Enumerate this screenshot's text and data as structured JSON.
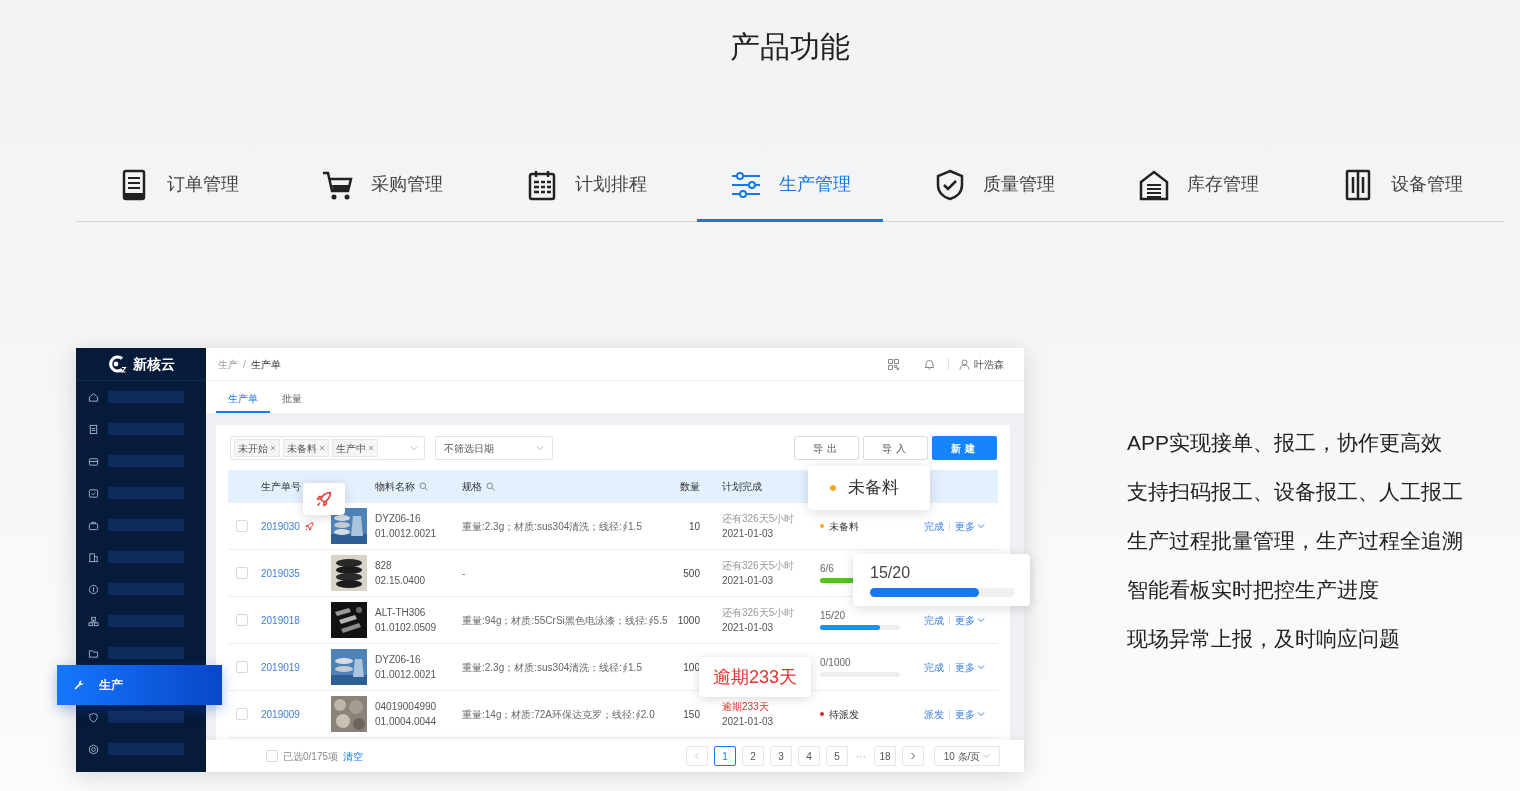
{
  "title": "产品功能",
  "feature_tabs": [
    {
      "label": "订单管理",
      "selected": false
    },
    {
      "label": "采购管理",
      "selected": false
    },
    {
      "label": "计划排程",
      "selected": false
    },
    {
      "label": "生产管理",
      "selected": true
    },
    {
      "label": "质量管理",
      "selected": false
    },
    {
      "label": "库存管理",
      "selected": false
    },
    {
      "label": "设备管理",
      "selected": false
    }
  ],
  "app": {
    "logo_text": "新核云",
    "sidebar": [
      {
        "selected": false
      },
      {
        "selected": false
      },
      {
        "selected": false
      },
      {
        "selected": false
      },
      {
        "selected": false
      },
      {
        "selected": false
      },
      {
        "selected": false
      },
      {
        "selected": false
      },
      {
        "selected": false
      },
      {
        "label": "生产",
        "selected": true
      },
      {
        "selected": false
      },
      {
        "selected": false
      }
    ],
    "breadcrumb": {
      "items": [
        "生产",
        "生产单"
      ],
      "separator": "/"
    },
    "user": "叶浩森",
    "tabs": [
      {
        "label": "生产单",
        "selected": true
      },
      {
        "label": "批量",
        "selected": false
      }
    ],
    "status_filter": {
      "tags": [
        "未开始",
        "未备料",
        "生产中"
      ]
    },
    "date_filter": {
      "value": "不筛选日期"
    },
    "buttons": [
      {
        "label": "导出",
        "kind": "default"
      },
      {
        "label": "导入",
        "kind": "default"
      },
      {
        "label": "新建",
        "kind": "primary"
      }
    ],
    "table": {
      "columns": [
        "生产单号",
        "物料名称",
        "规格",
        "数量",
        "计划完成"
      ],
      "rows": [
        {
          "checked": false,
          "id": "2019030",
          "rocket_mark": true,
          "image": {
            "kind": "picture"
          },
          "material": [
            "DYZ06-16",
            "01.0012.0021"
          ],
          "spec": "重量:2.3g；材质:sus304清洗；线径:∮1.5",
          "quantity": "10",
          "plan": {
            "remaining": "还有326天5小时",
            "overdue": false,
            "date": "2021-01-03"
          },
          "status": {
            "kind": "dot",
            "label": "未备料",
            "color": "#f5a623"
          },
          "actions": [
            "完成",
            "更多"
          ]
        },
        {
          "checked": false,
          "id": "2019035",
          "rocket_mark": false,
          "image": {
            "kind": "picture"
          },
          "material": [
            "828",
            "02.15.0400"
          ],
          "spec": "-",
          "quantity": "500",
          "plan": {
            "remaining": "还有326天5小时",
            "overdue": false,
            "date": "2021-01-03"
          },
          "status": {
            "kind": "progress",
            "reading": "6/6",
            "level": 1,
            "color": "#52c41a"
          }
        },
        {
          "checked": false,
          "id": "2019018",
          "rocket_mark": false,
          "image": {
            "kind": "picture"
          },
          "material": [
            "ALT-TH306",
            "01.0102.0509"
          ],
          "spec": "重量:94g；材质:55CrSi黑色电泳漆；线径:∮5.5",
          "quantity": "1000",
          "plan": {
            "remaining": "还有326天5小时",
            "overdue": false,
            "date": "2021-01-03"
          },
          "status": {
            "kind": "progress",
            "reading": "15/20",
            "level": 0.75,
            "color": "#1890ff"
          },
          "actions": [
            "完成",
            "更多"
          ]
        },
        {
          "checked": false,
          "id": "2019019",
          "rocket_mark": false,
          "image": {
            "kind": "picture"
          },
          "material": [
            "DYZ06-16",
            "01.0012.0021"
          ],
          "spec": "重量:2.3g；材质:sus304清洗；线径:∮1.5",
          "quantity": "100",
          "status": {
            "kind": "progress",
            "reading": "0/1000",
            "level": 0
          },
          "actions": [
            "完成",
            "更多"
          ]
        },
        {
          "checked": false,
          "id": "2019009",
          "rocket_mark": false,
          "image": {
            "kind": "picture"
          },
          "material": [
            "04019004990",
            "01.0004.0044"
          ],
          "spec": "重量:14g；材质:72A环保达克罗；线径:∮2.0",
          "quantity": "150",
          "plan": {
            "remaining": "逾期233天",
            "overdue": true,
            "date": "2021-01-03"
          },
          "status": {
            "kind": "dot",
            "label": "待派发",
            "color": "#e02020"
          },
          "actions": [
            "派发",
            "更多"
          ]
        }
      ]
    },
    "footer": {
      "checked": false,
      "selected_count": "已选0/175项",
      "clear": "清空"
    },
    "pagination": {
      "pages": [
        {
          "label": "1",
          "selected": true
        },
        {
          "label": "2",
          "selected": false
        },
        {
          "label": "3",
          "selected": false
        },
        {
          "label": "4",
          "selected": false
        },
        {
          "label": "5",
          "selected": false
        }
      ],
      "ellipsis": "···",
      "last": "18",
      "page_size": "10 条/页"
    },
    "popovers": [
      {
        "kind": "rocket"
      },
      {
        "kind": "status",
        "label": "未备料",
        "color": "#f5a623"
      },
      {
        "kind": "progress",
        "reading": "15/20",
        "level": 0.75
      },
      {
        "kind": "text",
        "text": "逾期233天"
      }
    ]
  },
  "highlights": [
    "APP实现接单、报工，协作更高效",
    "支持扫码报工、设备报工、人工报工",
    "生产过程批量管理，生产过程全追溯",
    "智能看板实时把控生产进度",
    "现场异常上报，及时响应问题"
  ]
}
